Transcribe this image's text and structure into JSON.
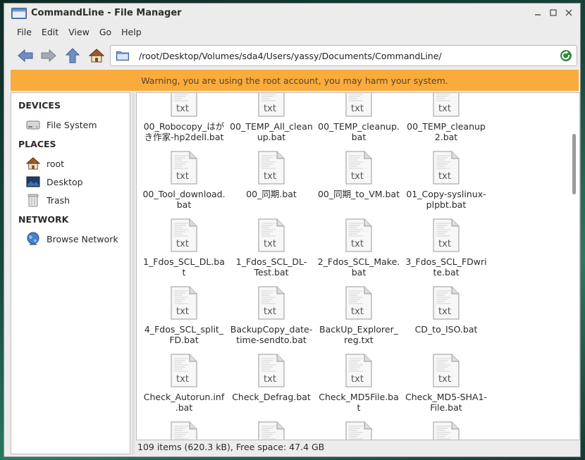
{
  "window": {
    "title": "CommandLine - File Manager"
  },
  "menubar": {
    "items": [
      "File",
      "Edit",
      "View",
      "Go",
      "Help"
    ]
  },
  "toolbar": {
    "path": "/root/Desktop/Volumes/sda4/Users/yassy/Documents/CommandLine/"
  },
  "warning": "Warning, you are using the root account, you may harm your system.",
  "sidebar": {
    "devices_heading": "DEVICES",
    "devices": [
      {
        "label": "File System",
        "icon": "drive-icon"
      }
    ],
    "places_heading": "PLACES",
    "places": [
      {
        "label": "root",
        "icon": "home-icon"
      },
      {
        "label": "Desktop",
        "icon": "desktop-icon"
      },
      {
        "label": "Trash",
        "icon": "trash-icon"
      }
    ],
    "network_heading": "NETWORK",
    "network": [
      {
        "label": "Browse Network",
        "icon": "globe-icon"
      }
    ]
  },
  "files": [
    "00_Robocopy_はがき作家-hp2dell.bat",
    "00_TEMP_All_cleanup.bat",
    "00_TEMP_cleanup.bat",
    "00_TEMP_cleanup2.bat",
    "00_Tool_download.bat",
    "00_同期.bat",
    "00_同期_to_VM.bat",
    "01_Copy-syslinux-plpbt.bat",
    "1_Fdos_SCL_DL.bat",
    "1_Fdos_SCL_DL-Test.bat",
    "2_Fdos_SCL_Make.bat",
    "3_Fdos_SCL_FDwrite.bat",
    "4_Fdos_SCL_split_FD.bat",
    "BackupCopy_date-time-sendto.bat",
    "BackUp_Explorer_reg.txt",
    "CD_to_ISO.bat",
    "Check_Autorun.inf.bat",
    "Check_Defrag.bat",
    "Check_MD5File.bat",
    "Check_MD5-SHA1-File.bat",
    "",
    "",
    "",
    ""
  ],
  "file_display_lines": [
    [
      "00_Robocopy_はが",
      "き作家-hp2dell.bat"
    ],
    [
      "00_TEMP_All_clean",
      "up.bat"
    ],
    [
      "00_TEMP_cleanup.",
      "bat"
    ],
    [
      "00_TEMP_cleanup",
      "2.bat"
    ],
    [
      "00_Tool_download.",
      "bat"
    ],
    [
      "00_同期.bat"
    ],
    [
      "00_同期_to_VM.bat"
    ],
    [
      "01_Copy-syslinux-",
      "plpbt.bat"
    ],
    [
      "1_Fdos_SCL_DL.ba",
      "t"
    ],
    [
      "1_Fdos_SCL_DL-",
      "Test.bat"
    ],
    [
      "2_Fdos_SCL_Make.",
      "bat"
    ],
    [
      "3_Fdos_SCL_FDwri",
      "te.bat"
    ],
    [
      "4_Fdos_SCL_split_",
      "FD.bat"
    ],
    [
      "BackupCopy_date-",
      "time-sendto.bat"
    ],
    [
      "BackUp_Explorer_",
      "reg.txt"
    ],
    [
      "CD_to_ISO.bat"
    ],
    [
      "Check_Autorun.inf",
      ".bat"
    ],
    [
      "Check_Defrag.bat"
    ],
    [
      "Check_MD5File.ba",
      "t"
    ],
    [
      "Check_MD5-SHA1-",
      "File.bat"
    ],
    [],
    [],
    [],
    []
  ],
  "file_icon_label": "txt",
  "statusbar": "109 items (620.3 kB), Free space: 47.4 GB"
}
